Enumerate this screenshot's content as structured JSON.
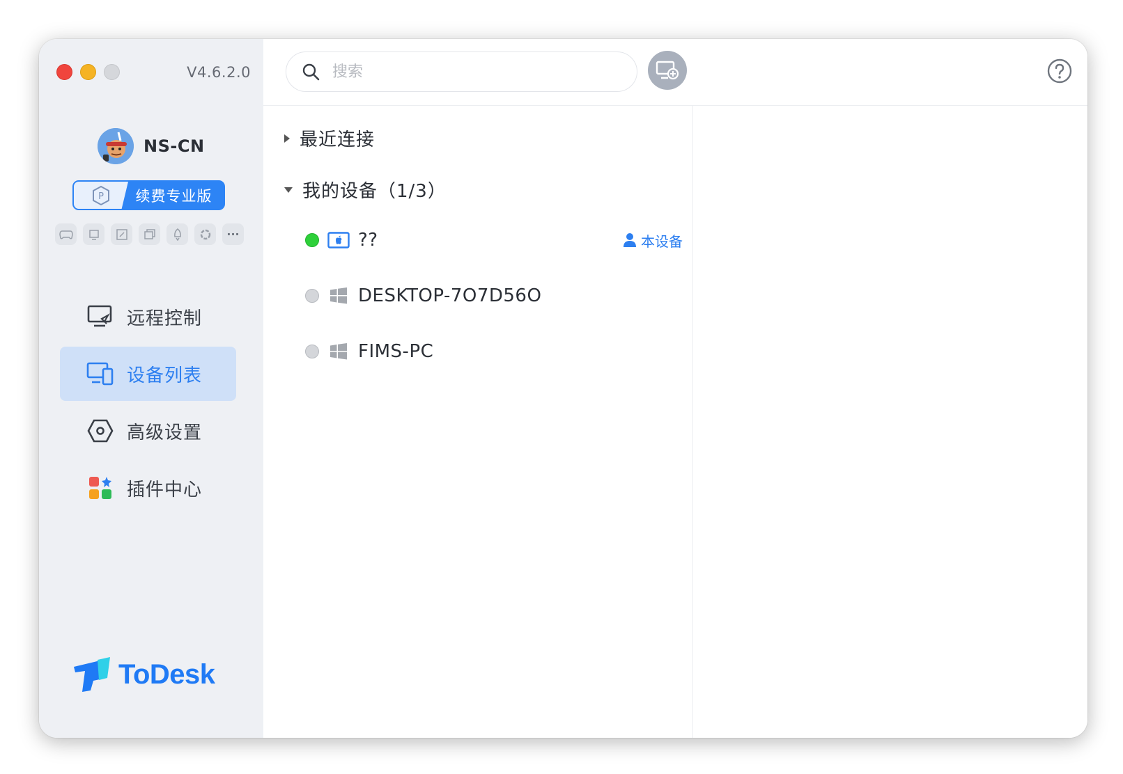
{
  "app": {
    "version": "V4.6.2.0",
    "brand_name": "ToDesk",
    "colors": {
      "accent": "#2d7ff0",
      "online": "#2ed03a",
      "offline": "#d4d6da"
    }
  },
  "profile": {
    "username": "NS-CN",
    "renew_label": "续费专业版"
  },
  "tools": [
    "gamepad-icon",
    "screen-icon",
    "board-icon",
    "window-icon",
    "rocket-icon",
    "circle-icon",
    "more-icon"
  ],
  "tools_more": "···",
  "nav": {
    "remote_control": "远程控制",
    "device_list": "设备列表",
    "advanced_settings": "高级设置",
    "plugin_center": "插件中心"
  },
  "search": {
    "placeholder": "搜索",
    "value": ""
  },
  "groups": {
    "recent": "最近连接",
    "my_devices": "我的设备（1/3）"
  },
  "devices": [
    {
      "name": "??",
      "os": "mac",
      "status": "online",
      "badge": "本设备"
    },
    {
      "name": "DESKTOP-7O7D56O",
      "os": "windows",
      "status": "offline"
    },
    {
      "name": "FIMS-PC",
      "os": "windows",
      "status": "offline"
    }
  ]
}
